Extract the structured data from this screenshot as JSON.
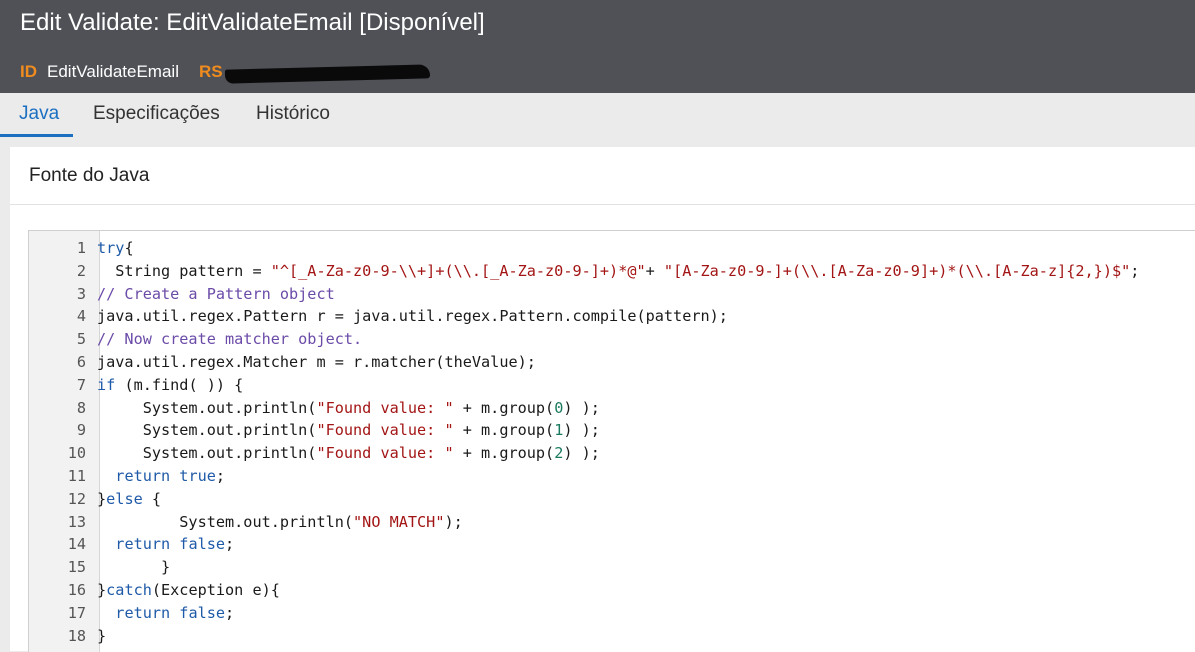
{
  "window": {
    "title": "Edit Validate: EditValidateEmail [Disponível]",
    "id_label": "ID",
    "id_value": "EditValidateEmail",
    "rs_label": "RS"
  },
  "tabs": [
    {
      "label": "Java",
      "active": true
    },
    {
      "label": "Especificações",
      "active": false
    },
    {
      "label": "Histórico",
      "active": false
    }
  ],
  "panel": {
    "title": "Fonte do Java"
  },
  "colors": {
    "header_bg": "#4f5157",
    "accent": "#1c6fc1",
    "label_orange": "#f08c1e"
  },
  "code": {
    "lines": [
      [
        {
          "t": "try",
          "c": "kw"
        },
        {
          "t": "{"
        }
      ],
      [
        {
          "t": "  String pattern = "
        },
        {
          "t": "\"^[_A-Za-z0-9-\\\\+]+(\\\\.[_A-Za-z0-9-]+)*@\"",
          "c": "str"
        },
        {
          "t": "+ "
        },
        {
          "t": "\"[A-Za-z0-9-]+(\\\\.[A-Za-z0-9]+)*(\\\\.[A-Za-z]{2,})$\"",
          "c": "str"
        },
        {
          "t": ";"
        }
      ],
      [
        {
          "t": "// Create a Pattern object",
          "c": "cm"
        }
      ],
      [
        {
          "t": "java.util.regex.Pattern r = java.util.regex.Pattern.compile(pattern);"
        }
      ],
      [
        {
          "t": "// Now create matcher object.",
          "c": "cm"
        }
      ],
      [
        {
          "t": "java.util.regex.Matcher m = r.matcher(theValue);"
        }
      ],
      [
        {
          "t": "if",
          "c": "kw"
        },
        {
          "t": " (m.find( )) {"
        }
      ],
      [
        {
          "t": "     System.out.println("
        },
        {
          "t": "\"Found value: \"",
          "c": "str"
        },
        {
          "t": " + m.group("
        },
        {
          "t": "0",
          "c": "num"
        },
        {
          "t": ") );"
        }
      ],
      [
        {
          "t": "     System.out.println("
        },
        {
          "t": "\"Found value: \"",
          "c": "str"
        },
        {
          "t": " + m.group("
        },
        {
          "t": "1",
          "c": "num"
        },
        {
          "t": ") );"
        }
      ],
      [
        {
          "t": "     System.out.println("
        },
        {
          "t": "\"Found value: \"",
          "c": "str"
        },
        {
          "t": " + m.group("
        },
        {
          "t": "2",
          "c": "num"
        },
        {
          "t": ") );"
        }
      ],
      [
        {
          "t": "  "
        },
        {
          "t": "return true",
          "c": "kw"
        },
        {
          "t": ";"
        }
      ],
      [
        {
          "t": "}"
        },
        {
          "t": "else",
          "c": "kw"
        },
        {
          "t": " {"
        }
      ],
      [
        {
          "t": "         System.out.println("
        },
        {
          "t": "\"NO MATCH\"",
          "c": "str"
        },
        {
          "t": ");"
        }
      ],
      [
        {
          "t": "  "
        },
        {
          "t": "return false",
          "c": "kw"
        },
        {
          "t": ";"
        }
      ],
      [
        {
          "t": "       }"
        }
      ],
      [
        {
          "t": "}"
        },
        {
          "t": "catch",
          "c": "kw"
        },
        {
          "t": "(Exception e){"
        }
      ],
      [
        {
          "t": "  "
        },
        {
          "t": "return false",
          "c": "kw"
        },
        {
          "t": ";"
        }
      ],
      [
        {
          "t": "}"
        }
      ]
    ]
  }
}
